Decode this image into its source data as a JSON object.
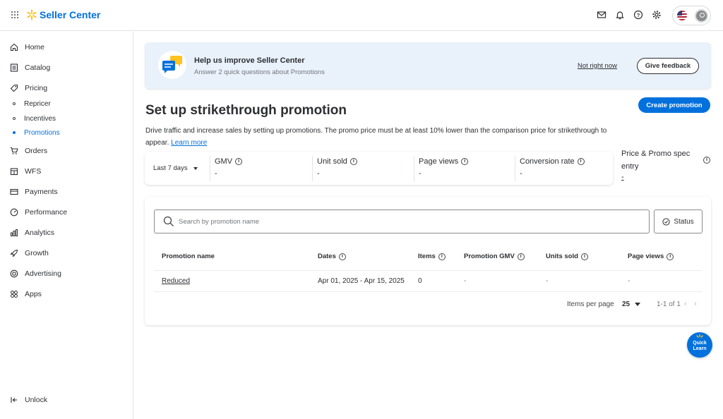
{
  "header": {
    "app_name": "Seller Center",
    "icons": [
      "apps-grid-icon",
      "mail-icon",
      "bell-icon",
      "help-icon",
      "gear-icon",
      "us-flag-icon",
      "user-avatar-icon"
    ]
  },
  "sidebar": {
    "items": [
      {
        "label": "Home",
        "icon": "home-icon"
      },
      {
        "label": "Catalog",
        "icon": "catalog-icon"
      },
      {
        "label": "Pricing",
        "icon": "tag-icon"
      },
      {
        "label": "Orders",
        "icon": "cart-icon"
      },
      {
        "label": "WFS",
        "icon": "warehouse-icon"
      },
      {
        "label": "Payments",
        "icon": "card-icon"
      },
      {
        "label": "Performance",
        "icon": "gauge-icon"
      },
      {
        "label": "Analytics",
        "icon": "bar-chart-icon"
      },
      {
        "label": "Growth",
        "icon": "rocket-icon"
      },
      {
        "label": "Advertising",
        "icon": "target-icon"
      },
      {
        "label": "Apps",
        "icon": "apps-icon"
      }
    ],
    "pricing_sub": [
      {
        "label": "Repricer"
      },
      {
        "label": "Incentives"
      },
      {
        "label": "Promotions",
        "active": true
      }
    ],
    "unlock_label": "Unlock"
  },
  "banner": {
    "title": "Help us improve Seller Center",
    "subtitle": "Answer 2 quick questions about Promotions",
    "not_now": "Not right now",
    "feedback": "Give feedback"
  },
  "page": {
    "title": "Set up strikethrough promotion",
    "create_button": "Create promotion",
    "description": "Drive traffic and increase sales by setting up promotions. The promo price must be at least 10% lower than the comparison price for strikethrough to appear.",
    "learn_more": "Learn more"
  },
  "metrics": {
    "period": "Last 7 days",
    "items": [
      {
        "label": "GMV",
        "value": "-"
      },
      {
        "label": "Unit sold",
        "value": "-"
      },
      {
        "label": "Page views",
        "value": "-"
      },
      {
        "label": "Conversion rate",
        "value": "-"
      }
    ],
    "spec": {
      "label": "Price & Promo spec entry",
      "value": "-"
    }
  },
  "table": {
    "search_placeholder": "Search by promotion name",
    "status_label": "Status",
    "columns": [
      "Promotion name",
      "Dates",
      "Items",
      "Promotion GMV",
      "Units sold",
      "Page views"
    ],
    "rows": [
      {
        "name": "Reduced",
        "dates": "Apr 01, 2025 - Apr 15, 2025",
        "items": "0",
        "gmv": "-",
        "units": "-",
        "views": "-"
      }
    ],
    "pager": {
      "label": "Items per page",
      "size": "25",
      "range": "1-1 of 1"
    }
  },
  "quick_learn": "Quick Learn",
  "colors": {
    "brand": "#0071dc",
    "spark": "#ffc220",
    "banner_bg": "#e9f1fb"
  }
}
